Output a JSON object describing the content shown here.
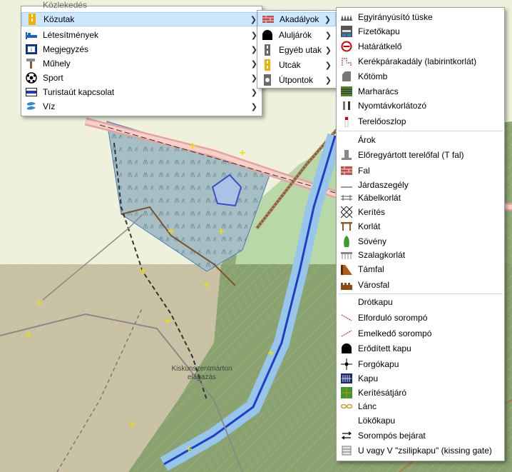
{
  "map": {
    "place_label": "Kiskunszentmárton elágazás",
    "place_label_line1": "Kiskunszentmárton",
    "place_label_line2": "elágazás",
    "cropped_top_label": "Közlekedés"
  },
  "colors": {
    "highlight_bg": "#cce8ff",
    "highlight_border": "#99d1ff",
    "river": "#1f3fc8",
    "forest": "#6f8f5c",
    "wetland": "#8fb0c8",
    "menu_bg": "#ffffff"
  },
  "menu1": {
    "items": [
      {
        "label": "Közutak",
        "icon": "road-icon",
        "has_submenu": true,
        "selected": true
      },
      {
        "label": "Létesítmények",
        "icon": "bed-icon",
        "has_submenu": true
      },
      {
        "label": "Megjegyzés",
        "icon": "note-icon",
        "has_submenu": true
      },
      {
        "label": "Műhely",
        "icon": "hammer-icon",
        "has_submenu": true
      },
      {
        "label": "Sport",
        "icon": "ball-icon",
        "has_submenu": true
      },
      {
        "label": "Turistaút kapcsolat",
        "icon": "trail-icon",
        "has_submenu": true
      },
      {
        "label": "Víz",
        "icon": "water-icon",
        "has_submenu": true
      }
    ]
  },
  "menu2": {
    "items": [
      {
        "label": "Akadályok",
        "icon": "barrier-icon",
        "has_submenu": true,
        "selected": true
      },
      {
        "label": "Aluljárók",
        "icon": "tunnel-icon",
        "has_submenu": true
      },
      {
        "label": "Egyéb utak",
        "icon": "road-grey-icon",
        "has_submenu": true
      },
      {
        "label": "Utcák",
        "icon": "street-icon",
        "has_submenu": true
      },
      {
        "label": "Útpontok",
        "icon": "waypoint-icon",
        "has_submenu": true
      }
    ]
  },
  "menu3": {
    "groups": [
      [
        {
          "label": "Egyirányúsító tüske",
          "icon": "spikes-icon"
        },
        {
          "label": "Fizetőkapu",
          "icon": "toll-booth-icon"
        },
        {
          "label": "Határátkelő",
          "icon": "border-control-icon"
        },
        {
          "label": "Kerékpárakadály (labirintkorlát)",
          "icon": "cycle-barrier-icon"
        },
        {
          "label": "Kőtömb",
          "icon": "block-icon"
        },
        {
          "label": "Marharács",
          "icon": "cattle-grid-icon"
        },
        {
          "label": "Nyomtávkorlátozó",
          "icon": "bollard-icon"
        },
        {
          "label": "Terelőoszlop",
          "icon": "post-icon"
        }
      ],
      [
        {
          "label": "Árok",
          "icon": "ditch-icon"
        },
        {
          "label": "Előregyártott terelőfal (T fal)",
          "icon": "t-wall-icon"
        },
        {
          "label": "Fal",
          "icon": "wall-icon"
        },
        {
          "label": "Járdaszegély",
          "icon": "kerb-icon"
        },
        {
          "label": "Kábelkorlát",
          "icon": "cable-barrier-icon"
        },
        {
          "label": "Kerítés",
          "icon": "fence-icon"
        },
        {
          "label": "Korlát",
          "icon": "guard-rail-icon"
        },
        {
          "label": "Sövény",
          "icon": "hedge-icon"
        },
        {
          "label": "Szalagkorlát",
          "icon": "rail-barrier-icon"
        },
        {
          "label": "Támfal",
          "icon": "retaining-wall-icon"
        },
        {
          "label": "Városfal",
          "icon": "city-wall-icon"
        }
      ],
      [
        {
          "label": "Drótkapu",
          "icon": "wire-gate-icon"
        },
        {
          "label": "Elforduló sorompó",
          "icon": "swing-gate-icon"
        },
        {
          "label": "Emelkedő sorompó",
          "icon": "lift-gate-icon"
        },
        {
          "label": "Erődített kapu",
          "icon": "fortified-gate-icon"
        },
        {
          "label": "Forgókapu",
          "icon": "turnstile-icon"
        },
        {
          "label": "Kapu",
          "icon": "gate-icon"
        },
        {
          "label": "Kerítésátjáró",
          "icon": "stile-icon"
        },
        {
          "label": "Lánc",
          "icon": "chain-icon"
        },
        {
          "label": "Lökőkapu",
          "icon": "swing-push-gate-icon"
        },
        {
          "label": "Sorompós bejárat",
          "icon": "barrier-entrance-icon"
        },
        {
          "label": "U vagy V \"zsilipkapu\" (kissing gate)",
          "icon": "kissing-gate-icon"
        }
      ]
    ]
  }
}
